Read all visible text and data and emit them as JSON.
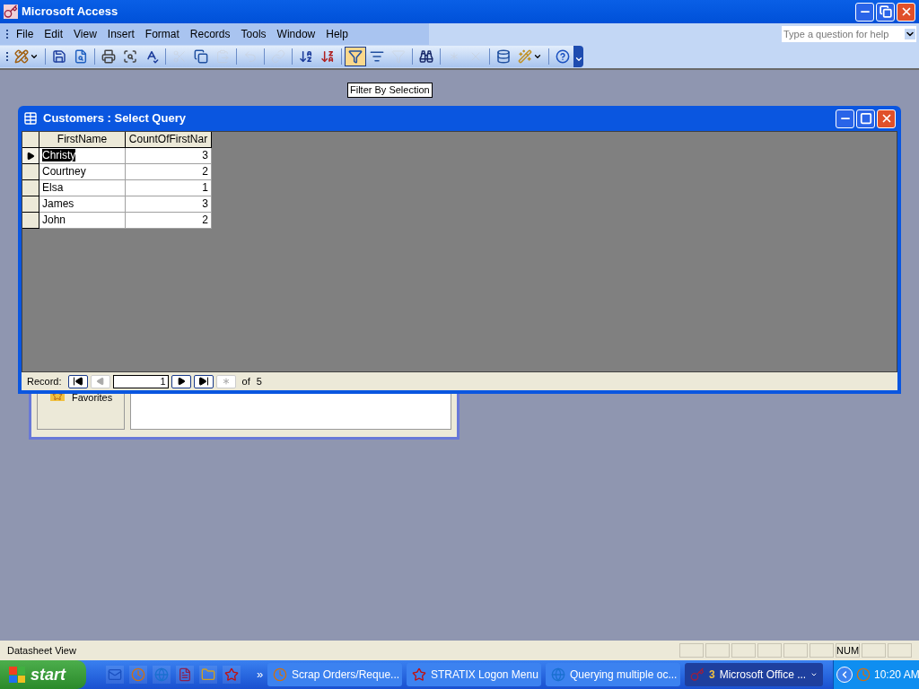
{
  "window": {
    "title": "Microsoft Access"
  },
  "menu": [
    "File",
    "Edit",
    "View",
    "Insert",
    "Format",
    "Records",
    "Tools",
    "Window",
    "Help"
  ],
  "help_search": {
    "placeholder": "Type a question for help"
  },
  "toolbar": [
    {
      "kind": "design",
      "disabled": false,
      "pressed": false
    },
    {
      "kind": "sep"
    },
    {
      "kind": "save",
      "disabled": false,
      "pressed": false
    },
    {
      "kind": "search-file",
      "disabled": false,
      "pressed": false
    },
    {
      "kind": "sep"
    },
    {
      "kind": "print",
      "disabled": false,
      "pressed": false
    },
    {
      "kind": "preview",
      "disabled": false,
      "pressed": false
    },
    {
      "kind": "spelling",
      "disabled": false,
      "pressed": false
    },
    {
      "kind": "sep"
    },
    {
      "kind": "cut",
      "disabled": true,
      "pressed": false
    },
    {
      "kind": "copy",
      "disabled": false,
      "pressed": false
    },
    {
      "kind": "paste",
      "disabled": true,
      "pressed": false
    },
    {
      "kind": "sep"
    },
    {
      "kind": "undo",
      "disabled": true,
      "pressed": false
    },
    {
      "kind": "sep"
    },
    {
      "kind": "hyperlink",
      "disabled": true,
      "pressed": false
    },
    {
      "kind": "sep"
    },
    {
      "kind": "sort-asc",
      "disabled": false,
      "pressed": false
    },
    {
      "kind": "sort-desc",
      "disabled": false,
      "pressed": false
    },
    {
      "kind": "sep"
    },
    {
      "kind": "filter-selection",
      "disabled": false,
      "pressed": true
    },
    {
      "kind": "filter-form",
      "disabled": false,
      "pressed": false
    },
    {
      "kind": "apply-filter",
      "disabled": true,
      "pressed": false
    },
    {
      "kind": "sep"
    },
    {
      "kind": "find",
      "disabled": false,
      "pressed": false
    },
    {
      "kind": "sep"
    },
    {
      "kind": "new-record",
      "disabled": true,
      "pressed": false
    },
    {
      "kind": "delete-record",
      "disabled": true,
      "pressed": false
    },
    {
      "kind": "sep"
    },
    {
      "kind": "database-window",
      "disabled": false,
      "pressed": false
    },
    {
      "kind": "new-object",
      "disabled": false,
      "pressed": false
    },
    {
      "kind": "sep"
    },
    {
      "kind": "help",
      "disabled": false,
      "pressed": false
    }
  ],
  "tooltip": "Filter By Selection",
  "query_window": {
    "title": "Customers : Select Query",
    "columns": [
      "FirstName",
      "CountOfFirstNar"
    ],
    "rows": [
      {
        "cells": [
          "Christy",
          "3"
        ],
        "selected": true
      },
      {
        "cells": [
          "Courtney",
          "2"
        ],
        "selected": false
      },
      {
        "cells": [
          "Elsa",
          "1"
        ],
        "selected": false
      },
      {
        "cells": [
          "James",
          "3"
        ],
        "selected": false
      },
      {
        "cells": [
          "John",
          "2"
        ],
        "selected": false
      }
    ],
    "record_nav": {
      "label": "Record:",
      "value": "1",
      "of": "of",
      "total": "5"
    }
  },
  "background_window": {
    "group": "Favorites"
  },
  "status_bar": {
    "text": "Datasheet View",
    "num_indicator": "NUM"
  },
  "taskbar": {
    "start": "start",
    "overflow": "»",
    "tasks": [
      {
        "kind": "clock",
        "label": "Scrap Orders/Reque...",
        "selected": false
      },
      {
        "kind": "stratix",
        "label": "STRATIX Logon Menu",
        "selected": false
      },
      {
        "kind": "browser",
        "label": "Querying multiple oc...",
        "selected": false
      },
      {
        "kind": "access",
        "count": "3",
        "label": "Microsoft Office ...",
        "selected": true
      }
    ],
    "clock": "10:20 AM"
  }
}
